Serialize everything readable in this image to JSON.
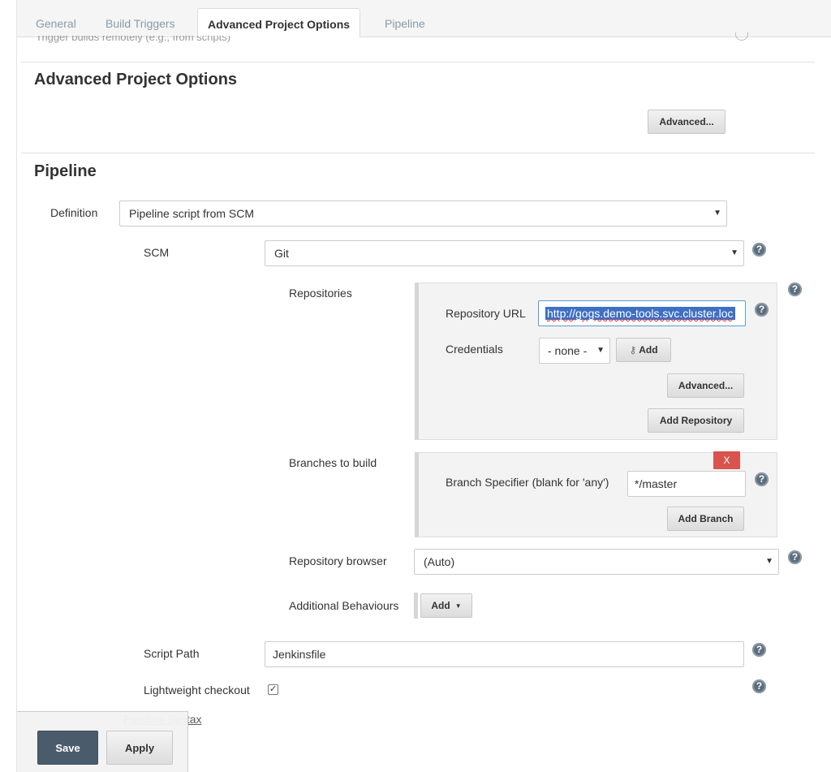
{
  "tabs": [
    {
      "label": "General"
    },
    {
      "label": "Build Triggers"
    },
    {
      "label": "Advanced Project Options"
    },
    {
      "label": "Pipeline"
    }
  ],
  "active_tab": "Advanced Project Options",
  "ghost_text": "Trigger builds remotely (e.g., from scripts)",
  "advanced_options": {
    "title": "Advanced Project Options",
    "advanced_button": "Advanced..."
  },
  "pipeline": {
    "title": "Pipeline",
    "definition_label": "Definition",
    "definition_value": "Pipeline script from SCM",
    "scm_label": "SCM",
    "scm_value": "Git",
    "repositories_label": "Repositories",
    "repo_url_label": "Repository URL",
    "repo_url_value": "http://gogs.demo-tools.svc.cluster.loc",
    "credentials_label": "Credentials",
    "credentials_value": "- none -",
    "add_credentials_button": "Add",
    "repo_advanced_button": "Advanced...",
    "add_repository_button": "Add Repository",
    "branches_label": "Branches to build",
    "remove_branch_button": "X",
    "branch_specifier_label": "Branch Specifier (blank for 'any')",
    "branch_specifier_value": "*/master",
    "add_branch_button": "Add Branch",
    "repo_browser_label": "Repository browser",
    "repo_browser_value": "(Auto)",
    "additional_behaviours_label": "Additional Behaviours",
    "additional_behaviours_button": "Add",
    "script_path_label": "Script Path",
    "script_path_value": "Jenkinsfile",
    "lightweight_label": "Lightweight checkout",
    "lightweight_checked": true,
    "syntax_link": "Pipeline Syntax"
  },
  "footer": {
    "save_label": "Save",
    "apply_label": "Apply"
  },
  "help_glyph": "?",
  "icons": {
    "help": "help-icon",
    "key": "key-icon",
    "caret": "chevron-down-icon"
  },
  "colors": {
    "save_button": "#4a5c6b",
    "remove_button": "#d9534f",
    "help_icon": "#5d6e7d"
  }
}
